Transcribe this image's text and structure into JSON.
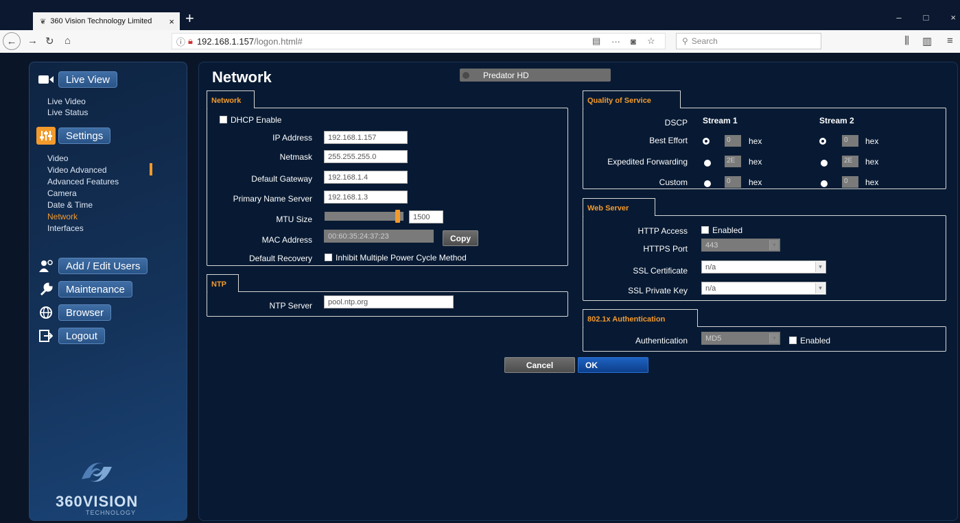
{
  "browser": {
    "tab_title": "360 Vision Technology Limited",
    "tab_close": "×",
    "new_tab": "+",
    "url_host": "192.168.1.157",
    "url_path": "/logon.html#",
    "search_placeholder": "Search",
    "win_min": "–",
    "win_max": "□",
    "win_close": "×"
  },
  "sidebar": {
    "live_view": "Live View",
    "live_items": [
      "Live Video",
      "Live Status"
    ],
    "settings": "Settings",
    "settings_items": [
      "Video",
      "Video Advanced",
      "Advanced Features",
      "Camera",
      "Date & Time",
      "Network",
      "Interfaces"
    ],
    "active_item": "Network",
    "add_edit_users": "Add / Edit Users",
    "maintenance": "Maintenance",
    "browser": "Browser",
    "logout": "Logout",
    "logo_main": "360VISION",
    "logo_sub": "TECHNOLOGY"
  },
  "page": {
    "title": "Network",
    "device_name": "Predator HD"
  },
  "network": {
    "tab": "Network",
    "dhcp_label": "DHCP Enable",
    "ip_label": "IP Address",
    "ip_value": "192.168.1.157",
    "netmask_label": "Netmask",
    "netmask_value": "255.255.255.0",
    "gateway_label": "Default Gateway",
    "gateway_value": "192.168.1.4",
    "dns_label": "Primary Name Server",
    "dns_value": "192.168.1.3",
    "mtu_label": "MTU Size",
    "mtu_value": "1500",
    "mtu_fraction": 0.95,
    "mac_label": "MAC Address",
    "mac_value": "00:60:35:24:37:23",
    "copy_label": "Copy",
    "recovery_label": "Default Recovery",
    "recovery_option": "Inhibit Multiple Power Cycle Method"
  },
  "ntp": {
    "tab": "NTP",
    "server_label": "NTP Server",
    "server_value": "pool.ntp.org"
  },
  "qos": {
    "tab": "Quality of Service",
    "dscp_label": "DSCP",
    "stream1": "Stream 1",
    "stream2": "Stream 2",
    "hex": "hex",
    "rows": [
      {
        "label": "Best Effort",
        "s1": "0",
        "s2": "0"
      },
      {
        "label": "Expedited Forwarding",
        "s1": "2E",
        "s2": "2E"
      },
      {
        "label": "Custom",
        "s1": "0",
        "s2": "0"
      }
    ]
  },
  "web_server": {
    "tab": "Web Server",
    "http_label": "HTTP Access",
    "http_option": "Enabled",
    "https_label": "HTTPS Port",
    "https_value": "443",
    "ssl_cert_label": "SSL Certificate",
    "ssl_cert_value": "n/a",
    "ssl_key_label": "SSL Private Key",
    "ssl_key_value": "n/a"
  },
  "auth": {
    "tab": "802.1x Authentication",
    "auth_label": "Authentication",
    "auth_value": "MD5",
    "enabled_label": "Enabled"
  },
  "actions": {
    "cancel": "Cancel",
    "ok": "OK"
  }
}
